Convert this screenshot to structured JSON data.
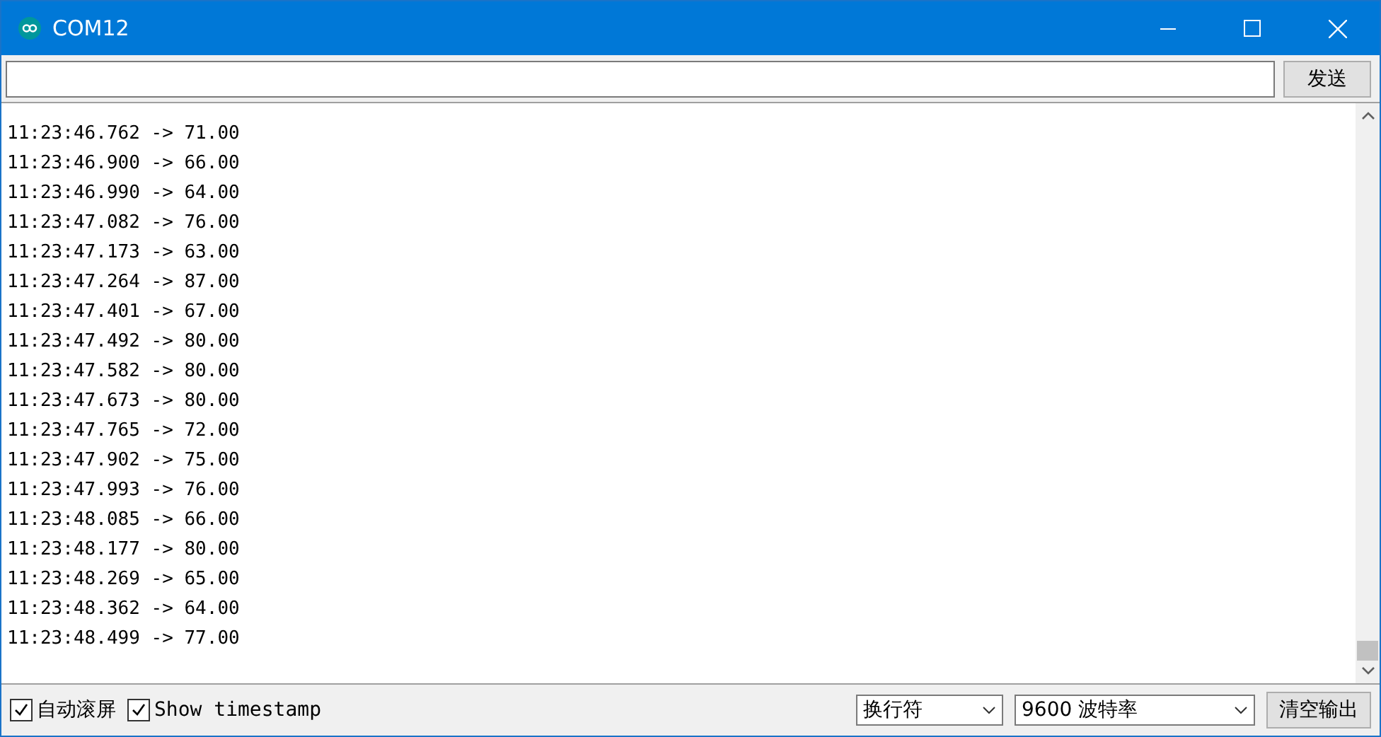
{
  "window": {
    "title": "COM12"
  },
  "send_button": "发送",
  "lines": [
    "11:23:46.762 -> 71.00",
    "11:23:46.900 -> 66.00",
    "11:23:46.990 -> 64.00",
    "11:23:47.082 -> 76.00",
    "11:23:47.173 -> 63.00",
    "11:23:47.264 -> 87.00",
    "11:23:47.401 -> 67.00",
    "11:23:47.492 -> 80.00",
    "11:23:47.582 -> 80.00",
    "11:23:47.673 -> 80.00",
    "11:23:47.765 -> 72.00",
    "11:23:47.902 -> 75.00",
    "11:23:47.993 -> 76.00",
    "11:23:48.085 -> 66.00",
    "11:23:48.177 -> 80.00",
    "11:23:48.269 -> 65.00",
    "11:23:48.362 -> 64.00",
    "11:23:48.499 -> 77.00"
  ],
  "options": [
    {
      "label": "自动滚屏",
      "checked": true
    },
    {
      "label": "Show timestamp",
      "checked": true
    }
  ],
  "line_ending": "换行符",
  "baud": "9600 波特率",
  "clear_button": "清空输出"
}
